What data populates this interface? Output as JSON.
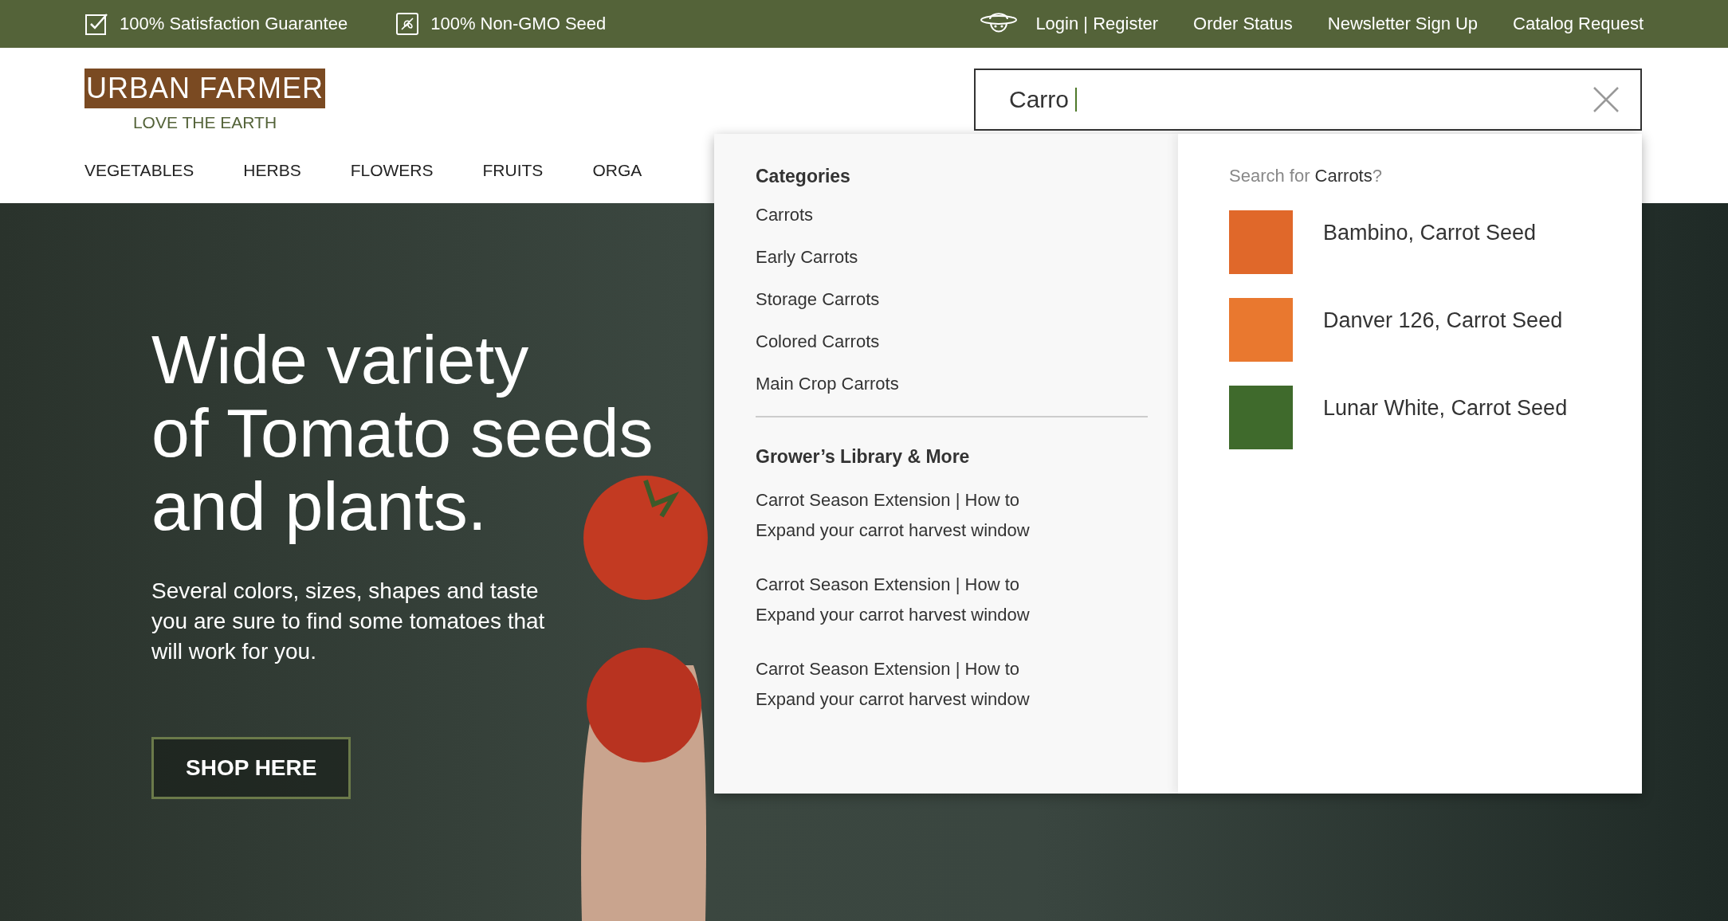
{
  "top_bar": {
    "promises": [
      {
        "kind": "check",
        "label": "100% Satisfaction Guarantee"
      },
      {
        "kind": "seed",
        "label": "100% Non-GMO Seed"
      }
    ],
    "links": [
      {
        "kind": "account",
        "label": "Login | Register"
      },
      {
        "kind": "plain",
        "label": "Order Status"
      },
      {
        "kind": "plain",
        "label": "Newsletter Sign Up"
      },
      {
        "kind": "plain",
        "label": "Catalog Request"
      }
    ]
  },
  "logo": {
    "name": "URBAN FARMER",
    "tagline": "LOVE THE EARTH"
  },
  "search": {
    "value": "Carro"
  },
  "nav": [
    "VEGETABLES",
    "HERBS",
    "FLOWERS",
    "FRUITS",
    "ORGA"
  ],
  "hero": {
    "headline": [
      "Wide variety",
      "of Tomato seeds",
      "and plants."
    ],
    "text": "Several colors, sizes, shapes and taste you are sure to find some tomatoes that will work for you.",
    "button": "SHOP HERE"
  },
  "dropdown": {
    "categories_title": "Categories",
    "categories": [
      "Carrots",
      "Early Carrots",
      "Storage Carrots",
      "Colored Carrots",
      "Main Crop Carrots"
    ],
    "library_title": "Grower’s Library & More",
    "articles": [
      "Carrot Season Extension | How to Expand your carrot harvest window",
      "Carrot Season Extension | How to Expand your carrot harvest window",
      "Carrot Season Extension | How to Expand your carrot harvest window"
    ],
    "suggestion": {
      "prefix": "Search for ",
      "term": "Carrots",
      "suffix": "?"
    },
    "products": [
      {
        "name": "Bambino, Carrot Seed",
        "color": "#e0682a"
      },
      {
        "name": "Danver 126, Carrot Seed",
        "color": "#e9782f"
      },
      {
        "name": "Lunar White, Carrot Seed",
        "color": "#3f6a2c"
      }
    ]
  }
}
